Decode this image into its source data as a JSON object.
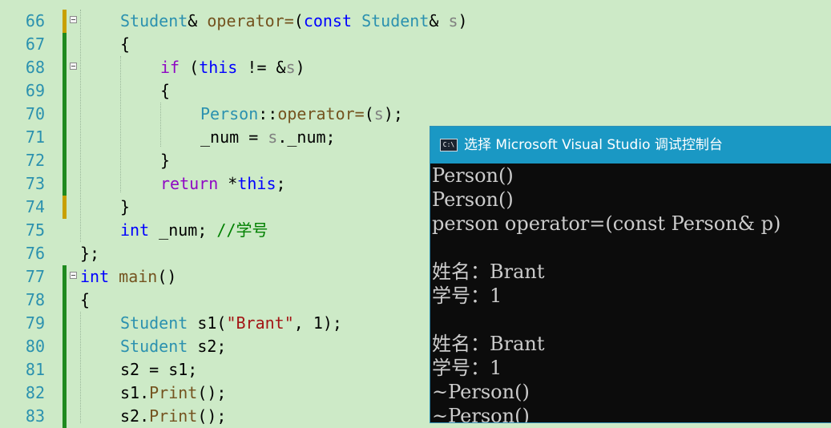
{
  "colors": {
    "background": "#cdeac7",
    "line_number": "#2b91af",
    "type": "#2b91af",
    "keyword": "#0000ff",
    "control_keyword": "#8f08c4",
    "function": "#74531f",
    "parameter": "#808080",
    "string": "#a31515",
    "comment": "#008000",
    "plain": "#000000",
    "change_saved": "#1f8a1f",
    "change_unsaved": "#c8a000",
    "console_title_bar": "#1a98c4",
    "console_background": "#0c0c0c",
    "console_text": "#cccccc"
  },
  "editor": {
    "lines": [
      {
        "number": "66",
        "fold": true,
        "bar": "unsaved",
        "indent": 1,
        "tokens": [
          {
            "t": "Student",
            "k": "type"
          },
          {
            "t": "& ",
            "k": "plain"
          },
          {
            "t": "operator=",
            "k": "function"
          },
          {
            "t": "(",
            "k": "plain"
          },
          {
            "t": "const",
            "k": "keyword"
          },
          {
            "t": " ",
            "k": "plain"
          },
          {
            "t": "Student",
            "k": "type"
          },
          {
            "t": "& ",
            "k": "plain"
          },
          {
            "t": "s",
            "k": "parameter"
          },
          {
            "t": ")",
            "k": "plain"
          }
        ]
      },
      {
        "number": "67",
        "fold": false,
        "bar": "saved",
        "indent": 1,
        "tokens": [
          {
            "t": "{",
            "k": "plain"
          }
        ]
      },
      {
        "number": "68",
        "fold": true,
        "bar": "saved",
        "indent": 2,
        "tokens": [
          {
            "t": "if",
            "k": "control_keyword"
          },
          {
            "t": " (",
            "k": "plain"
          },
          {
            "t": "this",
            "k": "keyword"
          },
          {
            "t": " != &",
            "k": "plain"
          },
          {
            "t": "s",
            "k": "parameter"
          },
          {
            "t": ")",
            "k": "plain"
          }
        ]
      },
      {
        "number": "69",
        "fold": false,
        "bar": "saved",
        "indent": 2,
        "tokens": [
          {
            "t": "{",
            "k": "plain"
          }
        ]
      },
      {
        "number": "70",
        "fold": false,
        "bar": "saved",
        "indent": 3,
        "tokens": [
          {
            "t": "Person",
            "k": "type"
          },
          {
            "t": "::",
            "k": "plain"
          },
          {
            "t": "operator=",
            "k": "function"
          },
          {
            "t": "(",
            "k": "plain"
          },
          {
            "t": "s",
            "k": "parameter"
          },
          {
            "t": ");",
            "k": "plain"
          }
        ]
      },
      {
        "number": "71",
        "fold": false,
        "bar": "saved",
        "indent": 3,
        "tokens": [
          {
            "t": "_num = ",
            "k": "plain"
          },
          {
            "t": "s",
            "k": "parameter"
          },
          {
            "t": "._num;",
            "k": "plain"
          }
        ]
      },
      {
        "number": "72",
        "fold": false,
        "bar": "saved",
        "indent": 2,
        "tokens": [
          {
            "t": "}",
            "k": "plain"
          }
        ]
      },
      {
        "number": "73",
        "fold": false,
        "bar": "saved",
        "indent": 2,
        "tokens": [
          {
            "t": "return",
            "k": "control_keyword"
          },
          {
            "t": " *",
            "k": "plain"
          },
          {
            "t": "this",
            "k": "keyword"
          },
          {
            "t": ";",
            "k": "plain"
          }
        ]
      },
      {
        "number": "74",
        "fold": false,
        "bar": "unsaved",
        "indent": 1,
        "tokens": [
          {
            "t": "}",
            "k": "plain"
          }
        ]
      },
      {
        "number": "75",
        "fold": false,
        "bar": "none",
        "indent": 1,
        "tokens": [
          {
            "t": "int",
            "k": "keyword"
          },
          {
            "t": " _num; ",
            "k": "plain"
          },
          {
            "t": "//学号",
            "k": "comment"
          }
        ]
      },
      {
        "number": "76",
        "fold": false,
        "bar": "none",
        "indent": 0,
        "tokens": [
          {
            "t": "};",
            "k": "plain"
          }
        ]
      },
      {
        "number": "77",
        "fold": true,
        "bar": "saved",
        "indent": 0,
        "tokens": [
          {
            "t": "int",
            "k": "keyword"
          },
          {
            "t": " ",
            "k": "plain"
          },
          {
            "t": "main",
            "k": "function"
          },
          {
            "t": "()",
            "k": "plain"
          }
        ]
      },
      {
        "number": "78",
        "fold": false,
        "bar": "saved",
        "indent": 0,
        "tokens": [
          {
            "t": "{",
            "k": "plain"
          }
        ]
      },
      {
        "number": "79",
        "fold": false,
        "bar": "saved",
        "indent": 1,
        "tokens": [
          {
            "t": "Student",
            "k": "type"
          },
          {
            "t": " s1(",
            "k": "plain"
          },
          {
            "t": "\"Brant\"",
            "k": "string"
          },
          {
            "t": ", 1);",
            "k": "plain"
          }
        ]
      },
      {
        "number": "80",
        "fold": false,
        "bar": "saved",
        "indent": 1,
        "tokens": [
          {
            "t": "Student",
            "k": "type"
          },
          {
            "t": " s2;",
            "k": "plain"
          }
        ]
      },
      {
        "number": "81",
        "fold": false,
        "bar": "saved",
        "indent": 1,
        "tokens": [
          {
            "t": "s2 = s1;",
            "k": "plain"
          }
        ]
      },
      {
        "number": "82",
        "fold": false,
        "bar": "saved",
        "indent": 1,
        "tokens": [
          {
            "t": "s1.",
            "k": "plain"
          },
          {
            "t": "Print",
            "k": "function"
          },
          {
            "t": "();",
            "k": "plain"
          }
        ]
      },
      {
        "number": "83",
        "fold": false,
        "bar": "saved",
        "indent": 1,
        "tokens": [
          {
            "t": "s2.",
            "k": "plain"
          },
          {
            "t": "Print",
            "k": "function"
          },
          {
            "t": "();",
            "k": "plain"
          }
        ]
      }
    ]
  },
  "console": {
    "icon_text": "C:\\",
    "title": "选择 Microsoft Visual Studio 调试控制台",
    "lines": [
      "Person()",
      "Person()",
      "person operator=(const Person& p)",
      "",
      "姓名：Brant",
      "学号：1",
      "",
      "姓名：Brant",
      "学号：1",
      "~Person()",
      "~Person()"
    ]
  }
}
